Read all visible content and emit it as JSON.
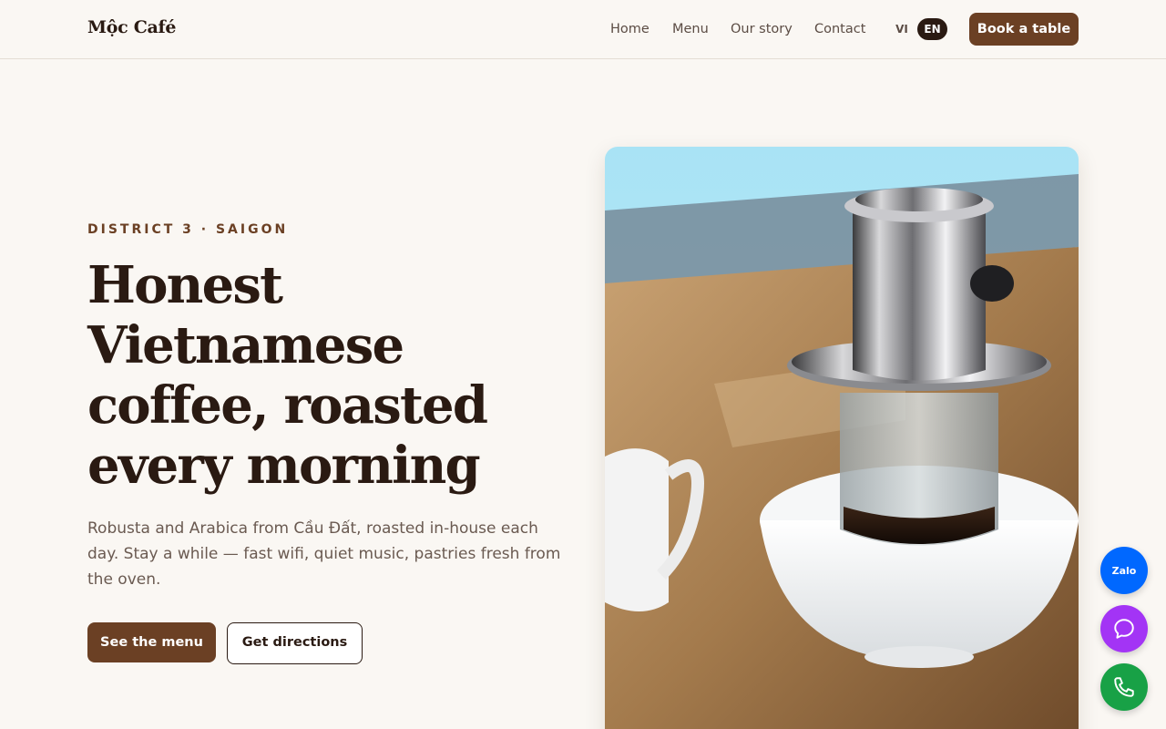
{
  "header": {
    "logo": "Mộc Café",
    "nav": [
      {
        "label": "Home"
      },
      {
        "label": "Menu"
      },
      {
        "label": "Our story"
      },
      {
        "label": "Contact"
      }
    ],
    "languages": {
      "vi": "VI",
      "en": "EN",
      "active": "EN"
    },
    "book_label": "Book a table"
  },
  "hero": {
    "eyebrow": "DISTRICT 3 · SAIGON",
    "headline": "Honest Vietnamese coffee, roasted every morning",
    "lede": "Robusta and Arabica from Cầu Đất, roasted in-house each day. Stay a while — fast wifi, quiet music, pastries fresh from the oven.",
    "primary_cta": "See the menu",
    "secondary_cta": "Get directions",
    "image_icon": "phin-coffee-filter-photo"
  },
  "floating": {
    "zalo_label": "Zalo",
    "chat_icon": "chat-bubble-icon",
    "phone_icon": "phone-icon"
  },
  "colors": {
    "background": "#faf7f3",
    "brand": "#6b4024",
    "text": "#2a1a12",
    "zalo": "#0068ff",
    "chat": "#a334f5",
    "phone": "#18a146"
  }
}
